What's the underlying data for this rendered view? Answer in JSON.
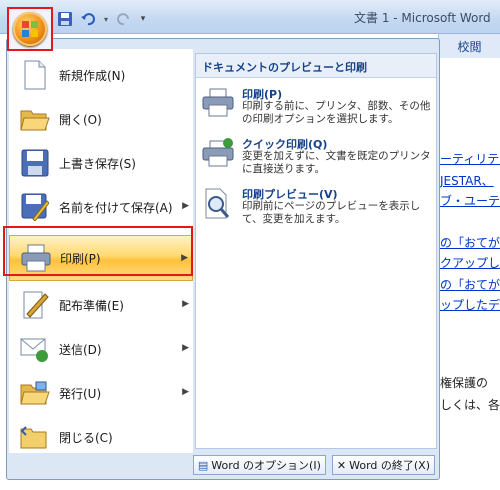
{
  "window": {
    "title": "文書 1 - Microsoft Word"
  },
  "ribbon": {
    "visible_tab": "校閲"
  },
  "menu": {
    "items": [
      {
        "label": "新規作成(N)",
        "icon": "new-document-icon"
      },
      {
        "label": "開く(O)",
        "icon": "open-folder-icon"
      },
      {
        "label": "上書き保存(S)",
        "icon": "save-disk-icon"
      },
      {
        "label": "名前を付けて保存(A)",
        "icon": "save-as-icon"
      },
      {
        "label": "印刷(P)",
        "icon": "printer-icon"
      },
      {
        "label": "配布準備(E)",
        "icon": "prepare-icon"
      },
      {
        "label": "送信(D)",
        "icon": "send-icon"
      },
      {
        "label": "発行(U)",
        "icon": "publish-icon"
      },
      {
        "label": "閉じる(C)",
        "icon": "close-folder-icon"
      }
    ],
    "submenu": {
      "header": "ドキュメントのプレビューと印刷",
      "items": [
        {
          "title": "印刷(P)",
          "desc": "印刷する前に、プリンタ、部数、その他の印刷オプションを選択します。"
        },
        {
          "title": "クイック印刷(Q)",
          "desc": "変更を加えずに、文書を既定のプリンタに直接送ります。"
        },
        {
          "title": "印刷プレビュー(V)",
          "desc": "印刷前にページのプレビューを表示して、変更を加えます。"
        }
      ]
    },
    "options_button": "Word のオプション(I)",
    "exit_button": "Word の終了(X)"
  },
  "document_fragments": [
    "ーティリティ",
    "JESTAR、",
    "ブ・ユーテ",
    "の「おてがる",
    "クアップし",
    "の「おてがる",
    "ップしたデ",
    "権保護の",
    "しくは、各"
  ],
  "colors": {
    "highlight_border": "#e01a1a",
    "active_item": "#ffd971",
    "accent": "#15428b"
  }
}
